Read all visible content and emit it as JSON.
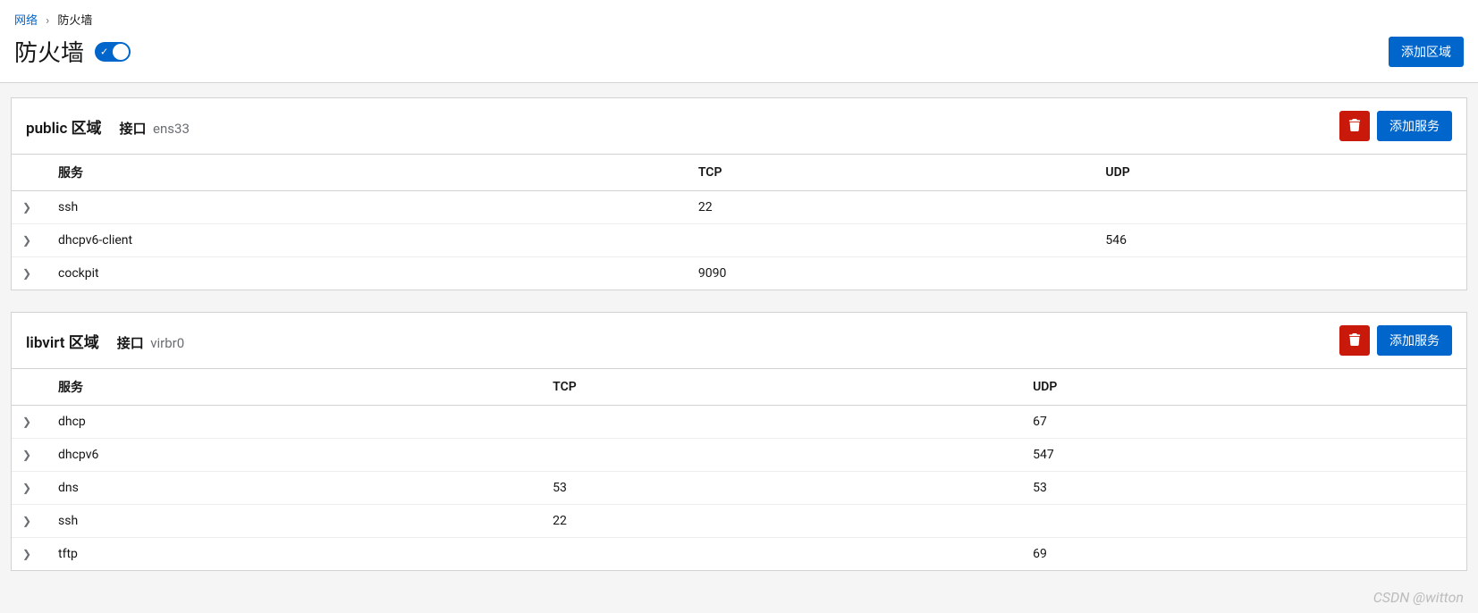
{
  "breadcrumb": {
    "parent": "网络",
    "current": "防火墙"
  },
  "page": {
    "title": "防火墙",
    "add_zone_label": "添加区域"
  },
  "table": {
    "col_service": "服务",
    "col_tcp": "TCP",
    "col_udp": "UDP"
  },
  "labels": {
    "zone_suffix": "区域",
    "interface": "接口",
    "add_service": "添加服务"
  },
  "zones": [
    {
      "name": "public",
      "interface": "ens33",
      "services": [
        {
          "name": "ssh",
          "tcp": "22",
          "udp": ""
        },
        {
          "name": "dhcpv6-client",
          "tcp": "",
          "udp": "546"
        },
        {
          "name": "cockpit",
          "tcp": "9090",
          "udp": ""
        }
      ]
    },
    {
      "name": "libvirt",
      "interface": "virbr0",
      "services": [
        {
          "name": "dhcp",
          "tcp": "",
          "udp": "67"
        },
        {
          "name": "dhcpv6",
          "tcp": "",
          "udp": "547"
        },
        {
          "name": "dns",
          "tcp": "53",
          "udp": "53"
        },
        {
          "name": "ssh",
          "tcp": "22",
          "udp": ""
        },
        {
          "name": "tftp",
          "tcp": "",
          "udp": "69"
        }
      ]
    }
  ],
  "watermark": "CSDN @witton"
}
